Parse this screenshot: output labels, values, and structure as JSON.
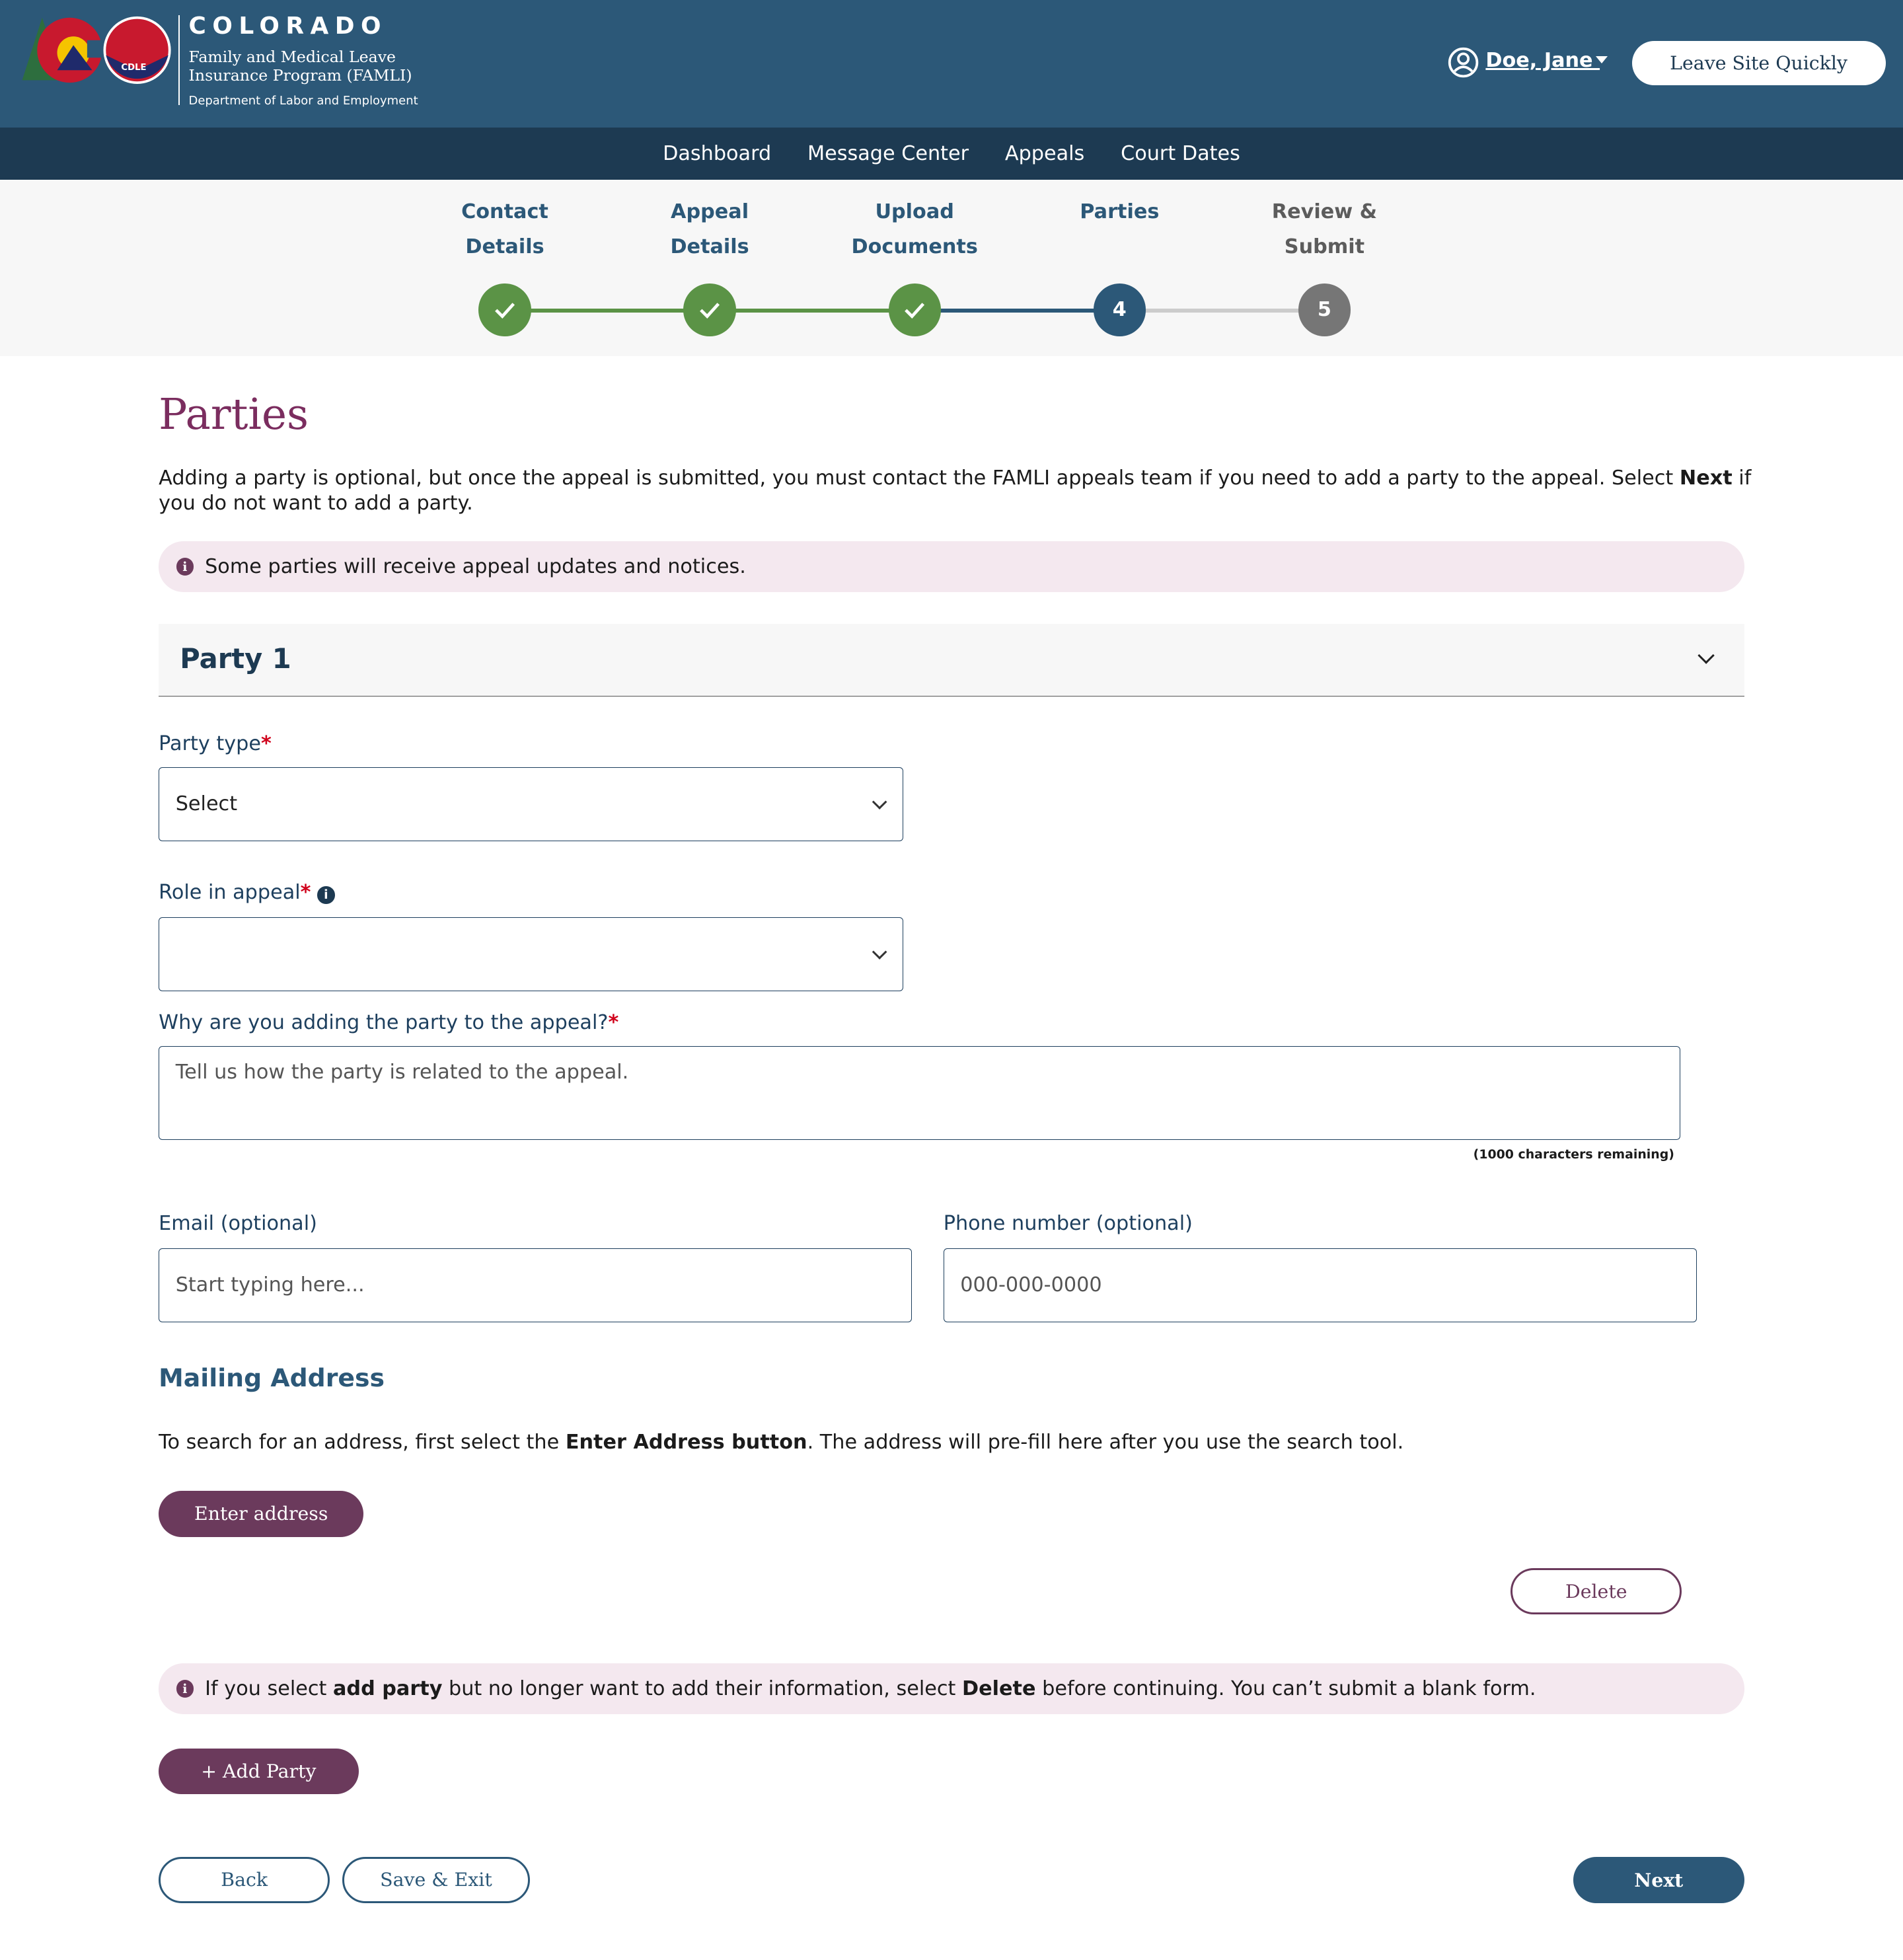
{
  "header": {
    "logo_text": "COLORADO",
    "program_line1": "Family and Medical Leave",
    "program_line2": "Insurance Program (FAMLI)",
    "department": "Department of Labor and Employment",
    "cdle": "CDLE",
    "user_name": "Doe, Jane ",
    "leave_button": "Leave Site Quickly"
  },
  "nav": {
    "items": [
      "Dashboard",
      "Message Center",
      "Appeals",
      "Court Dates"
    ]
  },
  "steps": [
    {
      "line1": "Contact",
      "line2": "Details",
      "status": "complete",
      "number": "1"
    },
    {
      "line1": "Appeal",
      "line2": "Details",
      "status": "complete",
      "number": "2"
    },
    {
      "line1": "Upload",
      "line2": "Documents",
      "status": "complete",
      "number": "3"
    },
    {
      "line1": "Parties",
      "line2": "",
      "status": "current",
      "number": "4"
    },
    {
      "line1": "Review &",
      "line2": "Submit",
      "status": "upcoming",
      "number": "5"
    }
  ],
  "colors": {
    "header": "#2c5878",
    "nav": "#1d3a52",
    "complete": "#5b9346",
    "current": "#2c5878",
    "upcoming": "#767676",
    "title": "#7b2d5f",
    "primary_purple": "#6b3a5c",
    "info_bg": "#f4e8ef"
  },
  "page": {
    "title": "Parties",
    "intro_a": "Adding a party is optional, but once the appeal is submitted, you must contact the FAMLI appeals team if you need to add a party to the appeal. Select ",
    "intro_bold": "Next",
    "intro_b": " if you do not want to add a party.",
    "info1": "Some parties will receive appeal updates and notices."
  },
  "party": {
    "heading": "Party 1",
    "party_type_label": "Party type",
    "party_type_value": "Select",
    "role_label": "Role in appeal",
    "role_value": "",
    "why_label": "Why are you adding the party to the appeal?",
    "why_placeholder": "Tell us how the party is related to the appeal.",
    "chars_remaining": "(1000 characters remaining)",
    "email_label": "Email (optional)",
    "email_placeholder": "Start typing here...",
    "phone_label": "Phone number (optional)",
    "phone_placeholder": "000-000-0000",
    "mailing_heading": "Mailing Address",
    "mailing_a": "To search for an address, first select the ",
    "mailing_bold": "Enter Address button",
    "mailing_b": ". The address will pre-fill here after you use the search tool.",
    "enter_address": "Enter address",
    "delete": "Delete"
  },
  "info2": {
    "a": "If you select ",
    "b1": "add party",
    "c": " but no longer want to add their information, select ",
    "b2": "Delete",
    "d": " before continuing. You can’t submit a blank form."
  },
  "actions": {
    "add_party": "+ Add Party",
    "back": "Back",
    "save_exit": "Save & Exit",
    "next": "Next"
  }
}
